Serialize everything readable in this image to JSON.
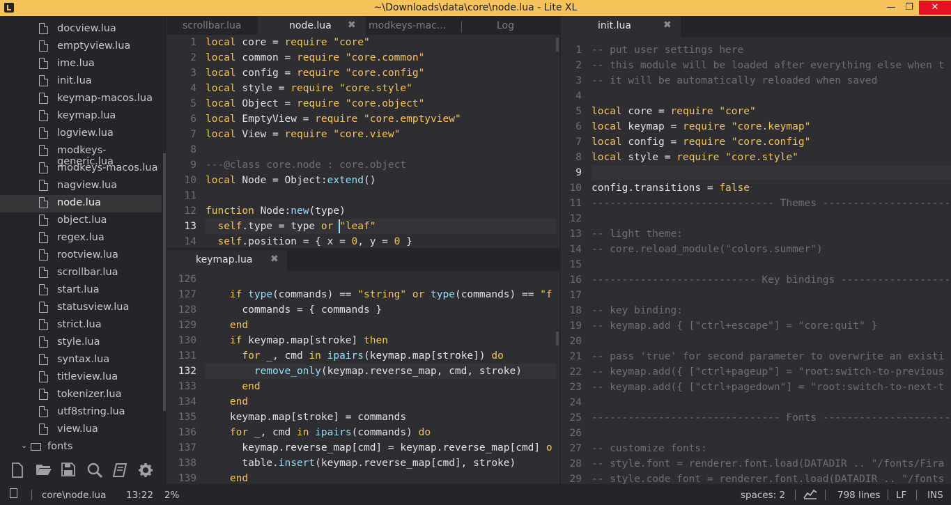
{
  "window": {
    "title": "~\\Downloads\\data\\core\\node.lua - Lite XL",
    "minimize": "—",
    "maximize": "❐",
    "close": "✕"
  },
  "sidebar": {
    "items": [
      {
        "label": "docview.lua",
        "type": "file"
      },
      {
        "label": "emptyview.lua",
        "type": "file"
      },
      {
        "label": "ime.lua",
        "type": "file"
      },
      {
        "label": "init.lua",
        "type": "file"
      },
      {
        "label": "keymap-macos.lua",
        "type": "file"
      },
      {
        "label": "keymap.lua",
        "type": "file"
      },
      {
        "label": "logview.lua",
        "type": "file"
      },
      {
        "label": "modkeys-generic.lua",
        "type": "file"
      },
      {
        "label": "modkeys-macos.lua",
        "type": "file"
      },
      {
        "label": "nagview.lua",
        "type": "file"
      },
      {
        "label": "node.lua",
        "type": "file",
        "selected": true
      },
      {
        "label": "object.lua",
        "type": "file"
      },
      {
        "label": "regex.lua",
        "type": "file"
      },
      {
        "label": "rootview.lua",
        "type": "file"
      },
      {
        "label": "scrollbar.lua",
        "type": "file"
      },
      {
        "label": "start.lua",
        "type": "file"
      },
      {
        "label": "statusview.lua",
        "type": "file"
      },
      {
        "label": "strict.lua",
        "type": "file"
      },
      {
        "label": "style.lua",
        "type": "file"
      },
      {
        "label": "syntax.lua",
        "type": "file"
      },
      {
        "label": "titleview.lua",
        "type": "file"
      },
      {
        "label": "tokenizer.lua",
        "type": "file"
      },
      {
        "label": "utf8string.lua",
        "type": "file"
      },
      {
        "label": "view.lua",
        "type": "file"
      },
      {
        "label": "fonts",
        "type": "folder"
      }
    ],
    "toolbar": [
      "new-file-icon",
      "open-folder-icon",
      "save-icon",
      "search-icon",
      "book-icon",
      "gear-icon"
    ]
  },
  "top_tabs": {
    "tabs": [
      {
        "label": "scrollbar.lua"
      },
      {
        "label": "node.lua",
        "active": true,
        "close": "✖"
      },
      {
        "label": "modkeys-mac..."
      },
      {
        "label": "Log"
      }
    ]
  },
  "node_editor": {
    "lines": [
      {
        "n": "1",
        "tokens": [
          [
            "k",
            "local"
          ],
          [
            "t",
            " core = "
          ],
          [
            "k",
            "require"
          ],
          [
            "t",
            " "
          ],
          [
            "s",
            "\"core\""
          ]
        ]
      },
      {
        "n": "2",
        "tokens": [
          [
            "k",
            "local"
          ],
          [
            "t",
            " common = "
          ],
          [
            "k",
            "require"
          ],
          [
            "t",
            " "
          ],
          [
            "s",
            "\"core.common\""
          ]
        ]
      },
      {
        "n": "3",
        "tokens": [
          [
            "k",
            "local"
          ],
          [
            "t",
            " config = "
          ],
          [
            "k",
            "require"
          ],
          [
            "t",
            " "
          ],
          [
            "s",
            "\"core.config\""
          ]
        ]
      },
      {
        "n": "4",
        "tokens": [
          [
            "k",
            "local"
          ],
          [
            "t",
            " style = "
          ],
          [
            "k",
            "require"
          ],
          [
            "t",
            " "
          ],
          [
            "s",
            "\"core.style\""
          ]
        ]
      },
      {
        "n": "5",
        "tokens": [
          [
            "k",
            "local"
          ],
          [
            "t",
            " Object = "
          ],
          [
            "k",
            "require"
          ],
          [
            "t",
            " "
          ],
          [
            "s",
            "\"core.object\""
          ]
        ]
      },
      {
        "n": "6",
        "tokens": [
          [
            "k",
            "local"
          ],
          [
            "t",
            " EmptyView = "
          ],
          [
            "k",
            "require"
          ],
          [
            "t",
            " "
          ],
          [
            "s",
            "\"core.emptyview\""
          ]
        ]
      },
      {
        "n": "7",
        "tokens": [
          [
            "k",
            "local"
          ],
          [
            "t",
            " View = "
          ],
          [
            "k",
            "require"
          ],
          [
            "t",
            " "
          ],
          [
            "s",
            "\"core.view\""
          ]
        ]
      },
      {
        "n": "8",
        "tokens": []
      },
      {
        "n": "9",
        "tokens": [
          [
            "c",
            "---@class core.node : core.object"
          ]
        ]
      },
      {
        "n": "10",
        "tokens": [
          [
            "k",
            "local"
          ],
          [
            "t",
            " Node = Object:"
          ],
          [
            "f",
            "extend"
          ],
          [
            "t",
            "()"
          ]
        ]
      },
      {
        "n": "11",
        "tokens": []
      },
      {
        "n": "12",
        "tokens": [
          [
            "k",
            "function"
          ],
          [
            "t",
            " Node:"
          ],
          [
            "f",
            "new"
          ],
          [
            "t",
            "(type)"
          ]
        ]
      },
      {
        "n": "13",
        "cur": true,
        "tokens": [
          [
            "t",
            "  "
          ],
          [
            "k",
            "self"
          ],
          [
            "t",
            ".type = type "
          ],
          [
            "k",
            "or"
          ],
          [
            "t",
            " "
          ],
          [
            "s",
            "\"leaf\""
          ]
        ]
      },
      {
        "n": "14",
        "tokens": [
          [
            "t",
            "  "
          ],
          [
            "k",
            "self"
          ],
          [
            "t",
            ".position = { x = "
          ],
          [
            "n",
            "0"
          ],
          [
            "t",
            ", y = "
          ],
          [
            "n",
            "0"
          ],
          [
            "t",
            " }"
          ]
        ]
      }
    ]
  },
  "keymap_tab": {
    "label": "keymap.lua",
    "close": "✖"
  },
  "keymap_editor": {
    "lines": [
      {
        "n": "126",
        "tokens": []
      },
      {
        "n": "127",
        "tokens": [
          [
            "t",
            "    "
          ],
          [
            "k",
            "if"
          ],
          [
            "t",
            " "
          ],
          [
            "f",
            "type"
          ],
          [
            "t",
            "(commands) == "
          ],
          [
            "s",
            "\"string\""
          ],
          [
            "t",
            " "
          ],
          [
            "k",
            "or"
          ],
          [
            "t",
            " "
          ],
          [
            "f",
            "type"
          ],
          [
            "t",
            "(commands) == "
          ],
          [
            "s",
            "\"f"
          ]
        ]
      },
      {
        "n": "128",
        "tokens": [
          [
            "t",
            "      commands = { commands }"
          ]
        ]
      },
      {
        "n": "129",
        "tokens": [
          [
            "t",
            "    "
          ],
          [
            "k",
            "end"
          ]
        ]
      },
      {
        "n": "130",
        "tokens": [
          [
            "t",
            "    "
          ],
          [
            "k",
            "if"
          ],
          [
            "t",
            " keymap.map[stroke] "
          ],
          [
            "k",
            "then"
          ]
        ]
      },
      {
        "n": "131",
        "tokens": [
          [
            "t",
            "      "
          ],
          [
            "k",
            "for"
          ],
          [
            "t",
            " _, cmd "
          ],
          [
            "k",
            "in"
          ],
          [
            "t",
            " "
          ],
          [
            "f",
            "ipairs"
          ],
          [
            "t",
            "(keymap.map[stroke]) "
          ],
          [
            "k",
            "do"
          ]
        ]
      },
      {
        "n": "132",
        "cur": true,
        "tokens": [
          [
            "t",
            "        "
          ],
          [
            "f",
            "remove_only"
          ],
          [
            "t",
            "(keymap.reverse_map, cmd, stroke)"
          ]
        ]
      },
      {
        "n": "133",
        "tokens": [
          [
            "t",
            "      "
          ],
          [
            "k",
            "end"
          ]
        ]
      },
      {
        "n": "134",
        "tokens": [
          [
            "t",
            "    "
          ],
          [
            "k",
            "end"
          ]
        ]
      },
      {
        "n": "135",
        "tokens": [
          [
            "t",
            "    keymap.map[stroke] = commands"
          ]
        ]
      },
      {
        "n": "136",
        "tokens": [
          [
            "t",
            "    "
          ],
          [
            "k",
            "for"
          ],
          [
            "t",
            " _, cmd "
          ],
          [
            "k",
            "in"
          ],
          [
            "t",
            " "
          ],
          [
            "f",
            "ipairs"
          ],
          [
            "t",
            "(commands) "
          ],
          [
            "k",
            "do"
          ]
        ]
      },
      {
        "n": "137",
        "tokens": [
          [
            "t",
            "      keymap.reverse_map[cmd] = keymap.reverse_map[cmd] "
          ],
          [
            "k",
            "o"
          ]
        ]
      },
      {
        "n": "138",
        "tokens": [
          [
            "t",
            "      table."
          ],
          [
            "f",
            "insert"
          ],
          [
            "t",
            "(keymap.reverse_map[cmd], stroke)"
          ]
        ]
      },
      {
        "n": "139",
        "tokens": [
          [
            "t",
            "    "
          ],
          [
            "k",
            "end"
          ]
        ]
      }
    ]
  },
  "init_tab": {
    "label": "init.lua",
    "close": "✖"
  },
  "init_editor": {
    "lines": [
      {
        "n": "1",
        "tokens": [
          [
            "c",
            "-- put user settings here"
          ]
        ]
      },
      {
        "n": "2",
        "tokens": [
          [
            "c",
            "-- this module will be loaded after everything else when t"
          ]
        ]
      },
      {
        "n": "3",
        "tokens": [
          [
            "c",
            "-- it will be automatically reloaded when saved"
          ]
        ]
      },
      {
        "n": "4",
        "tokens": []
      },
      {
        "n": "5",
        "tokens": [
          [
            "k",
            "local"
          ],
          [
            "t",
            " core = "
          ],
          [
            "k",
            "require"
          ],
          [
            "t",
            " "
          ],
          [
            "s",
            "\"core\""
          ]
        ]
      },
      {
        "n": "6",
        "tokens": [
          [
            "k",
            "local"
          ],
          [
            "t",
            " keymap = "
          ],
          [
            "k",
            "require"
          ],
          [
            "t",
            " "
          ],
          [
            "s",
            "\"core.keymap\""
          ]
        ]
      },
      {
        "n": "7",
        "tokens": [
          [
            "k",
            "local"
          ],
          [
            "t",
            " config = "
          ],
          [
            "k",
            "require"
          ],
          [
            "t",
            " "
          ],
          [
            "s",
            "\"core.config\""
          ]
        ]
      },
      {
        "n": "8",
        "tokens": [
          [
            "k",
            "local"
          ],
          [
            "t",
            " style = "
          ],
          [
            "k",
            "require"
          ],
          [
            "t",
            " "
          ],
          [
            "s",
            "\"core.style\""
          ]
        ]
      },
      {
        "n": "9",
        "cur": true,
        "tokens": []
      },
      {
        "n": "10",
        "tokens": [
          [
            "t",
            "config.transitions = "
          ],
          [
            "n",
            "false"
          ]
        ]
      },
      {
        "n": "11",
        "tokens": [
          [
            "c",
            "------------------------------ Themes ------------------------"
          ]
        ]
      },
      {
        "n": "12",
        "tokens": []
      },
      {
        "n": "13",
        "tokens": [
          [
            "c",
            "-- light theme:"
          ]
        ]
      },
      {
        "n": "14",
        "tokens": [
          [
            "c",
            "-- core.reload_module(\"colors.summer\")"
          ]
        ]
      },
      {
        "n": "15",
        "tokens": []
      },
      {
        "n": "16",
        "tokens": [
          [
            "c",
            "--------------------------- Key bindings ---------------------"
          ]
        ]
      },
      {
        "n": "17",
        "tokens": []
      },
      {
        "n": "18",
        "tokens": [
          [
            "c",
            "-- key binding:"
          ]
        ]
      },
      {
        "n": "19",
        "tokens": [
          [
            "c",
            "-- keymap.add { [\"ctrl+escape\"] = \"core:quit\" }"
          ]
        ]
      },
      {
        "n": "20",
        "tokens": []
      },
      {
        "n": "21",
        "tokens": [
          [
            "c",
            "-- pass 'true' for second parameter to overwrite an existi"
          ]
        ]
      },
      {
        "n": "22",
        "tokens": [
          [
            "c",
            "-- keymap.add({ [\"ctrl+pageup\"] = \"root:switch-to-previous"
          ]
        ]
      },
      {
        "n": "23",
        "tokens": [
          [
            "c",
            "-- keymap.add({ [\"ctrl+pagedown\"] = \"root:switch-to-next-t"
          ]
        ]
      },
      {
        "n": "24",
        "tokens": []
      },
      {
        "n": "25",
        "tokens": [
          [
            "c",
            "------------------------------- Fonts ------------------------"
          ]
        ]
      },
      {
        "n": "26",
        "tokens": []
      },
      {
        "n": "27",
        "tokens": [
          [
            "c",
            "-- customize fonts:"
          ]
        ]
      },
      {
        "n": "28",
        "tokens": [
          [
            "c",
            "-- style.font = renderer.font.load(DATADIR .. \"/fonts/Fira"
          ]
        ]
      },
      {
        "n": "29",
        "tokens": [
          [
            "c",
            "-- style.code_font = renderer.font.load(DATADIR .. \"/fonts"
          ]
        ]
      }
    ]
  },
  "statusbar": {
    "file": "core\\node.lua",
    "position": "13:22",
    "percent": "2%",
    "spaces": "spaces: 2",
    "lines": "798 lines",
    "eol": "LF",
    "mode": "INS"
  },
  "colors": {
    "accent": "#f6c35a",
    "keyword": "#f6c35a",
    "function": "#93ddfa",
    "comment": "#6e6e73",
    "background": "#2e2e32",
    "panel": "#252529"
  }
}
